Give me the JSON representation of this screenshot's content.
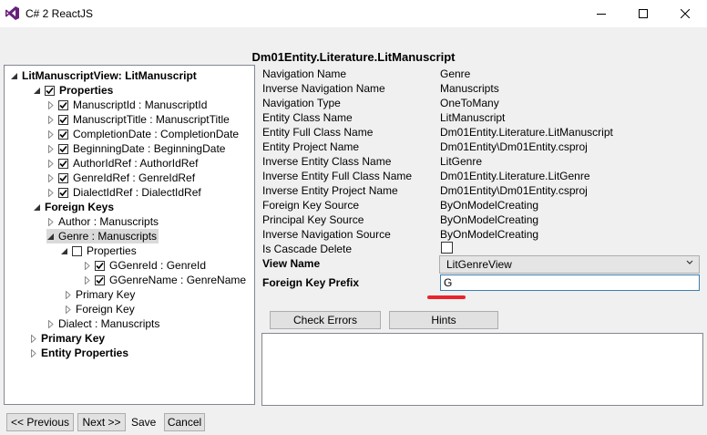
{
  "window": {
    "title": "C# 2 ReactJS",
    "controls": {
      "minimize": "—",
      "maximize": "☐",
      "close": "✕"
    }
  },
  "main_title": "Dm01Entity.Literature.LitManuscript",
  "tree": {
    "root": "LitManuscriptView: LitManuscript",
    "properties": "Properties",
    "property_items": [
      "ManuscriptId : ManuscriptId",
      "ManuscriptTitle : ManuscriptTitle",
      "CompletionDate : CompletionDate",
      "BeginningDate : BeginningDate",
      "AuthorIdRef : AuthorIdRef",
      "GenreIdRef : GenreIdRef",
      "DialectIdRef : DialectIdRef"
    ],
    "foreign_keys": "Foreign Keys",
    "fk_author": "Author : Manuscripts",
    "fk_genre": "Genre : Manuscripts",
    "genre_properties": "Properties",
    "genre_property_items": [
      "GGenreId : GenreId",
      "GGenreName : GenreName"
    ],
    "genre_primary_key": "Primary Key",
    "genre_foreign_key": "Foreign Key",
    "fk_dialect": "Dialect : Manuscripts",
    "primary_key": "Primary Key",
    "entity_properties": "Entity Properties"
  },
  "details": [
    {
      "label": "Navigation Name",
      "value": "Genre"
    },
    {
      "label": "Inverse Navigation Name",
      "value": "Manuscripts"
    },
    {
      "label": "Navigation Type",
      "value": "OneToMany"
    },
    {
      "label": "Entity Class Name",
      "value": "LitManuscript"
    },
    {
      "label": "Entity Full Class Name",
      "value": "Dm01Entity.Literature.LitManuscript"
    },
    {
      "label": "Entity Project Name",
      "value": "Dm01Entity\\Dm01Entity.csproj"
    },
    {
      "label": "Inverse Entity Class Name",
      "value": "LitGenre"
    },
    {
      "label": "Inverse Entity Full Class Name",
      "value": "Dm01Entity.Literature.LitGenre"
    },
    {
      "label": "Inverse Entity Project Name",
      "value": "Dm01Entity\\Dm01Entity.csproj"
    },
    {
      "label": "Foreign Key Source",
      "value": "ByOnModelCreating"
    },
    {
      "label": "Principal Key Source",
      "value": "ByOnModelCreating"
    },
    {
      "label": "Inverse Navigation Source",
      "value": "ByOnModelCreating"
    },
    {
      "label": "Is Cascade Delete",
      "value": ""
    }
  ],
  "view_name": {
    "label": "View Name",
    "selected": "LitGenreView"
  },
  "fk_prefix": {
    "label": "Foreign Key Prefix",
    "value": "G"
  },
  "buttons": {
    "check_errors": "Check Errors",
    "hints": "Hints",
    "previous": "<< Previous",
    "next": "Next >>",
    "save": "Save",
    "cancel": "Cancel"
  },
  "colors": {
    "accent": "#e8242c",
    "logo": "#68217a"
  }
}
